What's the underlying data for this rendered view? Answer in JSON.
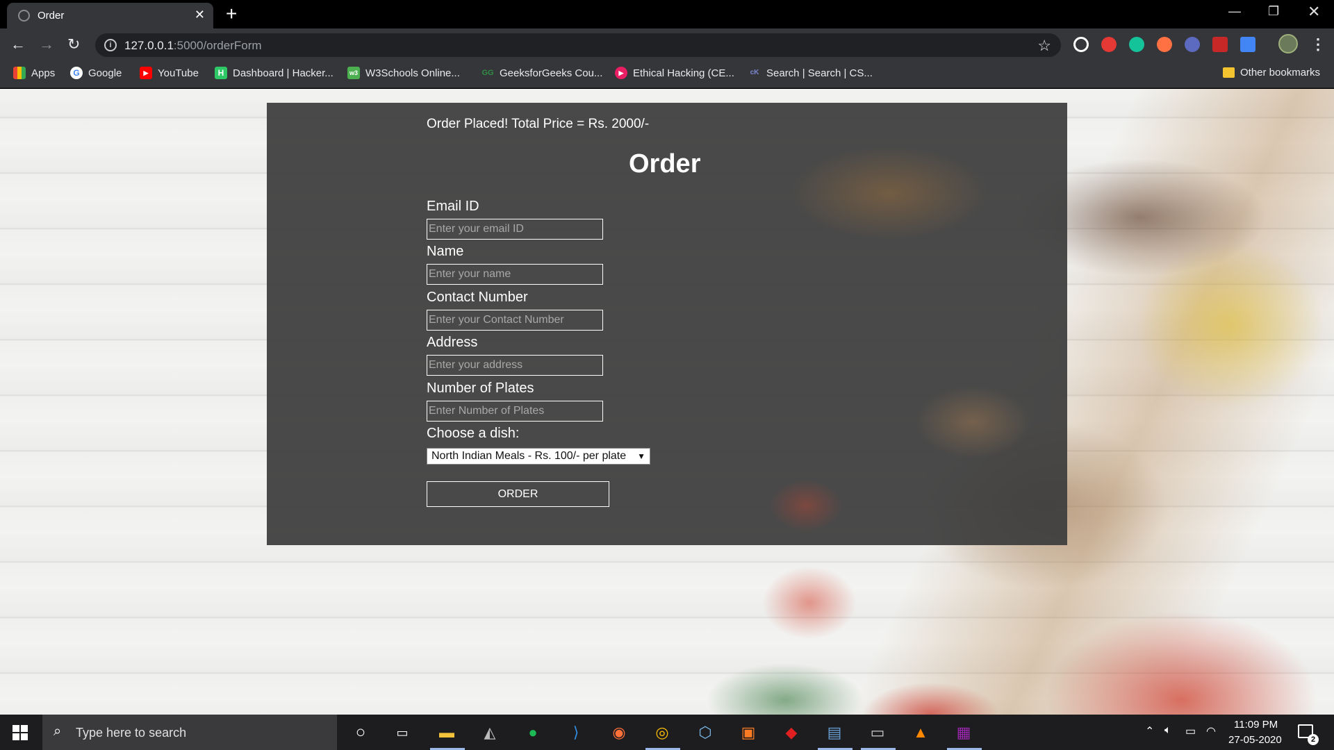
{
  "browser": {
    "tab_title": "Order",
    "url_host": "127.0.0.1",
    "url_path": ":5000/orderForm",
    "new_tab_label": "+",
    "tab_close_label": "✕",
    "back_label": "←",
    "forward_label": "→",
    "reload_label": "↻",
    "star_label": "☆",
    "menu_label": "⋮",
    "min_label": "—",
    "max_label": "❐",
    "close_label": "✕"
  },
  "bookmarks": [
    {
      "label": "Apps",
      "icon": "apps-grid-icon",
      "color": "#4285f4"
    },
    {
      "label": "Google",
      "icon": "google-icon",
      "color": "#ffffff"
    },
    {
      "label": "YouTube",
      "icon": "youtube-icon",
      "color": "#ff0000"
    },
    {
      "label": "Dashboard | Hacker...",
      "icon": "hackerrank-icon",
      "color": "#2ec866"
    },
    {
      "label": "W3Schools Online...",
      "icon": "w3schools-icon",
      "color": "#4caf50"
    },
    {
      "label": "GeeksforGeeks Cou...",
      "icon": "geeksforgeeks-icon",
      "color": "#2f8d46"
    },
    {
      "label": "Ethical Hacking (CE...",
      "icon": "ethical-hacking-icon",
      "color": "#e91e63"
    },
    {
      "label": "Search | Search | CS...",
      "icon": "search-cs-icon",
      "color": "#3f51b5"
    }
  ],
  "other_bookmarks": "Other bookmarks",
  "order": {
    "status_message": "Order Placed! Total Price = Rs. 2000/-",
    "title": "Order",
    "fields": [
      {
        "label": "Email ID",
        "placeholder": "Enter your email ID"
      },
      {
        "label": "Name",
        "placeholder": "Enter your name"
      },
      {
        "label": "Contact Number",
        "placeholder": "Enter your Contact Number"
      },
      {
        "label": "Address",
        "placeholder": "Enter your address"
      },
      {
        "label": "Number of Plates",
        "placeholder": "Enter Number of Plates"
      }
    ],
    "dish_label": "Choose a dish:",
    "dish_selected": "North Indian Meals - Rs. 100/- per plate",
    "submit_label": "ORDER"
  },
  "taskbar": {
    "search_placeholder": "Type here to search",
    "time": "11:09 PM",
    "date": "27-05-2020",
    "notification_count": "2",
    "pinned": [
      "cortana-icon",
      "task-view-icon",
      "file-explorer-icon",
      "predator-sense-icon",
      "spotify-icon",
      "vscode-icon",
      "firefox-icon",
      "chrome-icon",
      "virtualbox-icon",
      "xampp-icon",
      "acrobat-icon",
      "mysql-workbench-icon",
      "terminal-icon",
      "vlc-icon",
      "winrar-icon"
    ]
  },
  "colors": {
    "panel": "#3c3c3c",
    "chrome_dark": "#35363a",
    "taskbar": "#1d1d1f"
  }
}
